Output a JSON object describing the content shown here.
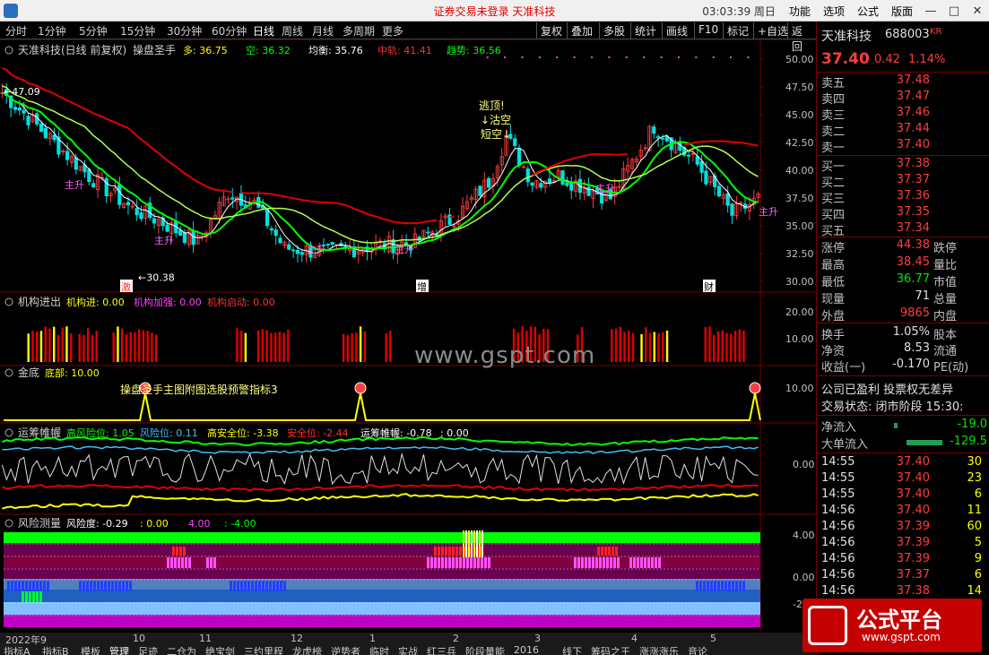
{
  "titlebar": {
    "title_parts": [
      "证券交易未登录",
      "天准科技"
    ],
    "clock": "03:03:39 周日",
    "menu": [
      "功能",
      "选项",
      "公式",
      "版面"
    ]
  },
  "toolbar": {
    "periods": [
      "分时",
      "1分钟",
      "5分钟",
      "15分钟",
      "30分钟",
      "60分钟",
      "日线",
      "周线",
      "月线",
      "多周期",
      "更多"
    ],
    "active_period": "日线",
    "buttons": [
      "复权",
      "叠加",
      "多股",
      "统计",
      "画线",
      "F10",
      "标记",
      "+自选",
      "返回"
    ]
  },
  "main_chart": {
    "title": "天准科技(日线 前复权)",
    "indicator": "操盘圣手",
    "params": [
      {
        "label": "多: 36.75",
        "color": "#ffff00"
      },
      {
        "label": "空: 36.32",
        "color": "#00ff00"
      },
      {
        "label": "均衡: 35.76",
        "color": "#ffffff"
      },
      {
        "label": "中轨: 41.41",
        "color": "#ff3030"
      },
      {
        "label": "趋势: 36.56",
        "color": "#00ff00"
      }
    ],
    "y_ticks": [
      "50.00",
      "47.50",
      "45.00",
      "42.50",
      "40.00",
      "37.50",
      "35.00",
      "32.50",
      "30.00"
    ],
    "high_marker": "47.09",
    "low_marker": "30.38",
    "annotations": [
      "逃顶!",
      "↓沽空",
      "短空↓"
    ],
    "markers": [
      {
        "label": "主升",
        "x": 172,
        "y": 272
      },
      {
        "label": "主升",
        "x": 72,
        "y": 210
      },
      {
        "label": "主升",
        "x": 342,
        "y": 282
      },
      {
        "label": "主升",
        "x": 440,
        "y": 282
      },
      {
        "label": "主升",
        "x": 664,
        "y": 214
      },
      {
        "label": "主升",
        "x": 846,
        "y": 240
      }
    ],
    "event_labels": [
      "激",
      "增",
      "财"
    ]
  },
  "panel2": {
    "title": "机构进出",
    "params": [
      {
        "label": "机构进: 0.00",
        "color": "#ffff00"
      },
      {
        "label": "机构加强: 0.00",
        "color": "#ff40ff"
      },
      {
        "label": "机构启动: 0.00",
        "color": "#ff3030"
      }
    ],
    "y_ticks": [
      "20.00",
      "10.00"
    ]
  },
  "panel3": {
    "title": "金底",
    "params": [
      {
        "label": "底部: 10.00",
        "color": "#ffff00"
      }
    ],
    "y_ticks": [
      "10.00"
    ],
    "caption": "操盘圣手主图附图选股预警指标3"
  },
  "panel4": {
    "title": "运筹帷幄",
    "params": [
      {
        "label": "高风险位: 1.05",
        "color": "#00ff00"
      },
      {
        "label": "风险位: 0.11",
        "color": "#40c0ff"
      },
      {
        "label": "高安全位: -3.38",
        "color": "#ffff00"
      },
      {
        "label": "安全位: -2.44",
        "color": "#ff3030"
      },
      {
        "label": "运筹帷幄: -0.78",
        "color": "#ffffff"
      },
      {
        "label": ": 0.00",
        "color": "#ffffff"
      }
    ],
    "y_ticks": [
      "0.00"
    ]
  },
  "panel5": {
    "title": "风险测量",
    "params": [
      {
        "label": "风险度: -0.29",
        "color": "#ffffff"
      },
      {
        "label": ": 0.00",
        "color": "#ffff00"
      },
      {
        "label": "4.00",
        "color": "#ff40ff"
      },
      {
        "label": ": -4.00",
        "color": "#00ff00"
      }
    ],
    "y_ticks": [
      "4.00",
      "0.00",
      "-2."
    ]
  },
  "x_axis": [
    "2022年9",
    "10",
    "11",
    "12",
    "1",
    "2",
    "3",
    "4",
    "5"
  ],
  "bottom_tabs": [
    "指标A",
    "指标B",
    "模板",
    "管理",
    "足迹",
    "二仓为",
    "绝宝剑",
    "三约里程",
    "龙虎榜",
    "逆势者",
    "临时",
    "实战",
    "红三兵",
    "阶段量能",
    "2016",
    "线下",
    "筹码之王",
    "涨涨涨乐",
    "音论"
  ],
  "quote": {
    "name": "天准科技",
    "code": "688003",
    "badge": "KR",
    "price": "37.40",
    "change": "0.42",
    "pct": "1.14%",
    "asks": [
      {
        "label": "卖五",
        "price": "37.48"
      },
      {
        "label": "卖四",
        "price": "37.47"
      },
      {
        "label": "卖三",
        "price": "37.46"
      },
      {
        "label": "卖二",
        "price": "37.44"
      },
      {
        "label": "卖一",
        "price": "37.40"
      }
    ],
    "bids": [
      {
        "label": "买一",
        "price": "37.38"
      },
      {
        "label": "买二",
        "price": "37.37"
      },
      {
        "label": "买三",
        "price": "37.36"
      },
      {
        "label": "买四",
        "price": "37.35"
      },
      {
        "label": "买五",
        "price": "37.34"
      }
    ],
    "stats": [
      {
        "l1": "涨停",
        "v1": "44.38",
        "c1": "red",
        "l2": "跌停"
      },
      {
        "l1": "最高",
        "v1": "38.45",
        "c1": "red",
        "l2": "量比"
      },
      {
        "l1": "最低",
        "v1": "36.77",
        "c1": "green",
        "l2": "市值"
      },
      {
        "l1": "现量",
        "v1": "71",
        "c1": "white",
        "l2": "总量"
      },
      {
        "l1": "外盘",
        "v1": "9865",
        "c1": "red",
        "l2": "内盘"
      }
    ],
    "fin": [
      {
        "l1": "换手",
        "v1": "1.05%",
        "l2": "股本"
      },
      {
        "l1": "净资",
        "v1": "8.53",
        "l2": "流通"
      },
      {
        "l1": "收益(一)",
        "v1": "-0.170",
        "l2": "PE(动)"
      }
    ],
    "status1": "公司已盈利 投票权无差异",
    "status2": "交易状态: 闭市阶段 15:30:",
    "flows": [
      {
        "label": "净流入",
        "value": "-19.0"
      },
      {
        "label": "大单流入",
        "value": "-129.5"
      }
    ],
    "ticks": [
      {
        "time": "14:55",
        "price": "37.40",
        "vol": "30",
        "pc": "red"
      },
      {
        "time": "14:55",
        "price": "37.40",
        "vol": "23",
        "pc": "red"
      },
      {
        "time": "14:55",
        "price": "37.40",
        "vol": "6",
        "pc": "red"
      },
      {
        "time": "14:56",
        "price": "37.40",
        "vol": "11",
        "pc": "red"
      },
      {
        "time": "14:56",
        "price": "37.39",
        "vol": "60",
        "pc": "red"
      },
      {
        "time": "14:56",
        "price": "37.39",
        "vol": "5",
        "pc": "red"
      },
      {
        "time": "14:56",
        "price": "37.39",
        "vol": "9",
        "pc": "red"
      },
      {
        "time": "14:56",
        "price": "37.37",
        "vol": "6",
        "pc": "red"
      },
      {
        "time": "14:56",
        "price": "37.38",
        "vol": "14",
        "pc": "red"
      }
    ]
  },
  "watermarks": {
    "site": "www.gspt.com",
    "logo_text": "公式平台",
    "logo_url": "www.gspt.com"
  }
}
